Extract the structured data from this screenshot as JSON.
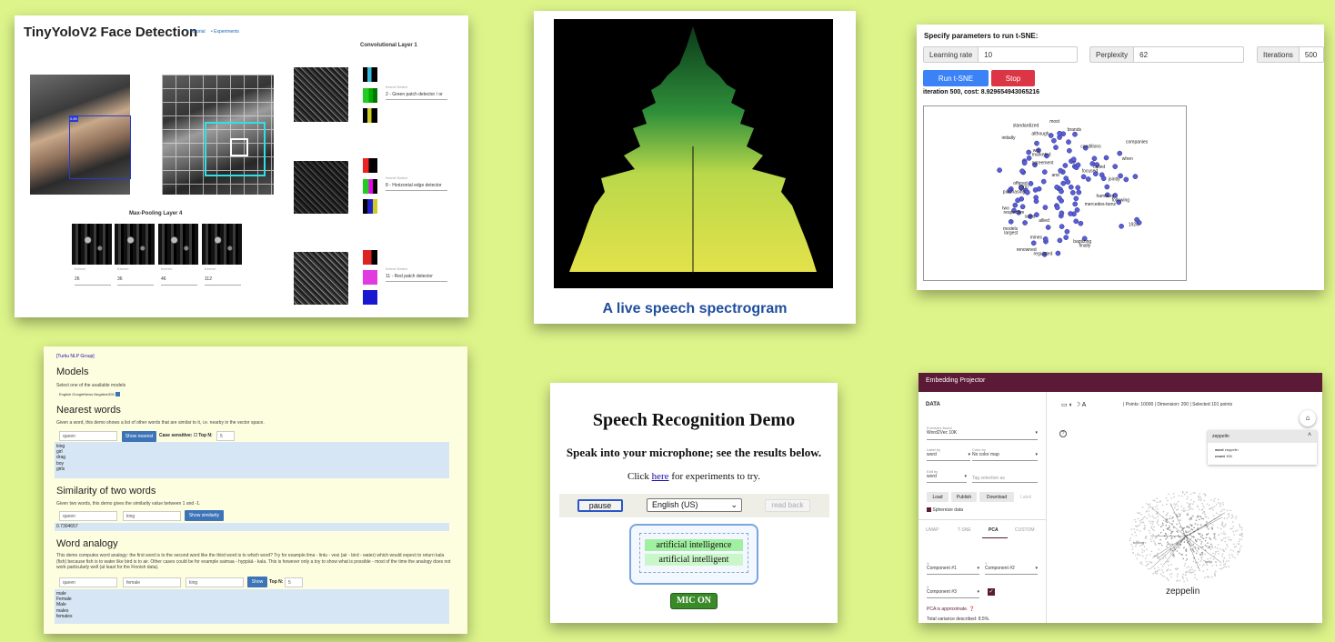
{
  "tinyyolo": {
    "title": "TinyYoloV2 Face Detection",
    "nav_tutorial": "Tutorial",
    "nav_experiments": "Experiments",
    "conv_title": "Convolutional Layer 1",
    "pool_title": "Max-Pooling Layer 4",
    "face_label": "0.89",
    "kernel_select_label": "Kernel Select",
    "kernels": [
      {
        "value": "2 - Green patch detector / or"
      },
      {
        "value": "8 - Horizontal edge detector"
      },
      {
        "value": "11 - Red patch detector"
      }
    ],
    "pool_kernel_label": "Kernel:",
    "pool_kernels": [
      "26",
      "36",
      "46",
      "112"
    ]
  },
  "spectrogram": {
    "caption": "A live speech spectrogram"
  },
  "tsne": {
    "header": "Specify parameters to run t-SNE:",
    "learning_rate_label": "Learning rate",
    "learning_rate_value": "10",
    "perplexity_label": "Perplexity",
    "perplexity_value": "62",
    "iterations_label": "Iterations",
    "iterations_value": "500",
    "run_label": "Run t-SNE",
    "stop_label": "Stop",
    "status": "iteration 500, cost: 8.929654943065216",
    "words": [
      "most",
      "standardized",
      "brands",
      "although",
      "initially",
      "companies",
      "conditions",
      "war",
      "marketed",
      "when",
      "agreement",
      "called",
      "focused",
      "and",
      "jointly",
      "offered",
      "2000",
      "purchasing",
      "hamburg",
      "following",
      "mercedes-benz",
      "two",
      "respective",
      "sales",
      "allied",
      "1926",
      "models",
      "largest",
      "mines",
      "baptizing",
      "finally",
      "renowned",
      "regulated"
    ],
    "run_color": "#3b82f6",
    "stop_color": "#dc3545"
  },
  "turku": {
    "group_link": "[Turku NLP Group]",
    "models_title": "Models",
    "models_desc": "Select one of the available models",
    "model_selected": "English GoogleNews Negative300",
    "nearest_title": "Nearest words",
    "nearest_desc": "Given a word, this demo shows a list of other words that are similar to it, i.e. nearby in the vector space.",
    "nearest_input": "queen",
    "nearest_button": "Show nearest",
    "case_label": "Case sensitive:",
    "topn_label": "Top N:",
    "topn_value": "5",
    "nearest_results": [
      "king",
      "girl",
      "drag",
      "boy",
      "girls"
    ],
    "similarity_title": "Similarity of two words",
    "similarity_desc": "Given two words, this demo gives the similarity value between 1 and -1.",
    "sim_input1": "queen",
    "sim_input2": "king",
    "sim_button": "Show similarity",
    "sim_result": "0.7304657",
    "analogy_title": "Word analogy",
    "analogy_desc": "This demo computes word analogy: the first word is to the second word like the third word is to which word? Try for example ilma - lintu - vesi (air - bird - water) which would expect to return kala (fish) because fish is to water like bird is to air. Other cases could be for example saimaa - hyppää - kala. This is however only a toy to show what is possible - most of the time the analogy does not work particularly well (at least for the Finnish data).",
    "an_input1": "queen",
    "an_input2": "female",
    "an_input3": "king",
    "an_button": "Show",
    "an_topn_value": "5",
    "analogy_results": [
      "male",
      "Female",
      "Male",
      "males",
      "females"
    ]
  },
  "speech": {
    "title": "Speech Recognition Demo",
    "subtitle": "Speak into your microphone; see the results below.",
    "click_prefix": "Click ",
    "click_link": "here",
    "click_suffix": " for experiments to try.",
    "pause_label": "pause",
    "language": "English (US)",
    "read_back_label": "read back",
    "result1": "artificial intelligence",
    "result2": "artificial intelligent",
    "mic_label": "MIC ON"
  },
  "projector": {
    "app_title": "Embedding Projector",
    "data_header": "DATA",
    "tensors_found_label": "5 tensors found",
    "tensor_value": "Word2Vec 10K",
    "label_by_label": "Label by",
    "label_by_value": "word",
    "color_by_label": "Color by",
    "color_by_value": "No color map",
    "edit_by_label": "Edit by",
    "edit_by_value": "word",
    "tag_placeholder": "Tag selection as",
    "load_label": "Load",
    "publish_label": "Publish",
    "download_label": "Download",
    "label_label": "Label",
    "sphereize_label": "Sphereize data",
    "tabs": [
      "UMAP",
      "T-SNE",
      "PCA",
      "CUSTOM"
    ],
    "x_label": "X",
    "x_value": "Component #1",
    "y_label": "Y",
    "y_value": "Component #2",
    "z_label": "Z",
    "z_value": "Component #3",
    "pca_note": "PCA is approximate.",
    "variance": "Total variance described: 8.5%.",
    "stats": "| Points: 10000 | Dimension: 200 | Selected 101 points",
    "selected_word": "zeppelin",
    "info_word_label": "word",
    "info_word_value": "zeppelin",
    "info_count_label": "count",
    "info_count_value": "156",
    "cloud_label_big": "zeppelin",
    "cloud_labels": [
      "boeing",
      "kelly",
      "james"
    ],
    "accent": "#5b1a36"
  }
}
